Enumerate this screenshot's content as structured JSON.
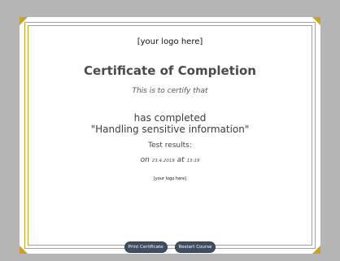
{
  "certificate": {
    "logo_top": "[your logo here]",
    "title": "Certificate of Completion",
    "certify_text": "This is to certify that",
    "completed_line1": "has completed",
    "course_name": "\"Handling sensitive information\"",
    "test_results": "Test results:",
    "on_label": "on",
    "date": "23.4.2019",
    "at_label": "at",
    "time": "13:19",
    "logo_bottom": "[your logo here]"
  },
  "buttons": {
    "print": "Print Certificate",
    "restart": "Restart Course"
  },
  "colors": {
    "frame": "#c9a227",
    "button_bg": "#3f4e63",
    "page_bg": "#b5b5b5"
  }
}
